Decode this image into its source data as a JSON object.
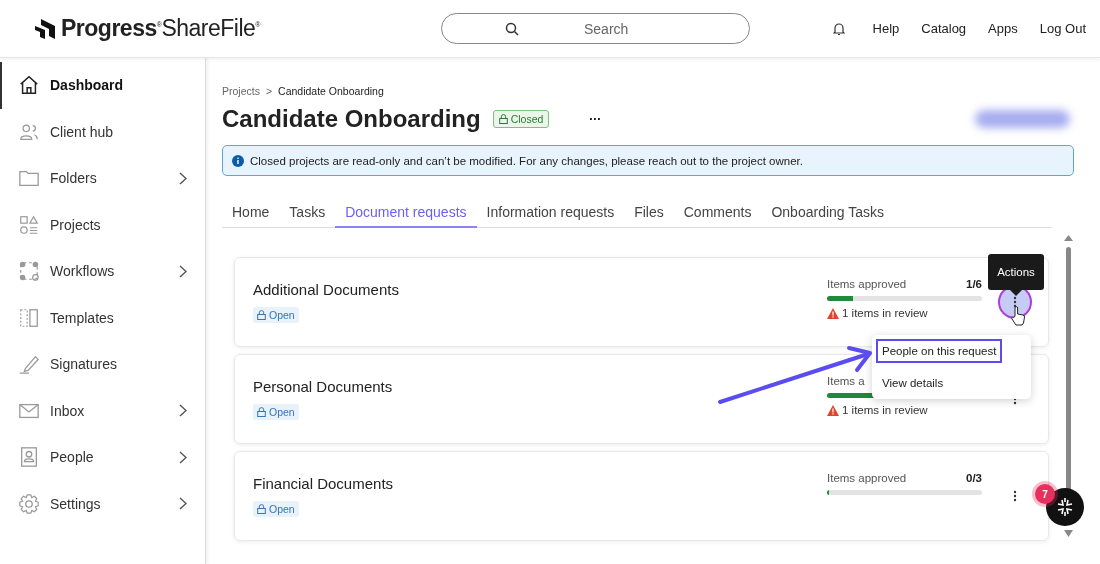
{
  "header": {
    "logo": "**Progress**$^{®}$ShareFile$^{®}$",
    "search": {
      "placeholder": "Search"
    },
    "links": [
      "Help",
      "Catalog",
      "Apps",
      "Log Out"
    ]
  },
  "sidebar": {
    "items": [
      {
        "label": "Dashboard",
        "kind": "home",
        "selected": true,
        "expandable": false
      },
      {
        "label": "Client hub",
        "kind": "users",
        "selected": false,
        "expandable": false
      },
      {
        "label": "Folders",
        "kind": "folder",
        "selected": false,
        "expandable": true
      },
      {
        "label": "Projects",
        "kind": "shapes",
        "selected": false,
        "expandable": false
      },
      {
        "label": "Workflows",
        "kind": "flow",
        "selected": false,
        "expandable": true
      },
      {
        "label": "Templates",
        "kind": "template",
        "selected": false,
        "expandable": false
      },
      {
        "label": "Signatures",
        "kind": "pen",
        "selected": false,
        "expandable": false
      },
      {
        "label": "Inbox",
        "kind": "mail",
        "selected": false,
        "expandable": true
      },
      {
        "label": "People",
        "kind": "person",
        "selected": false,
        "expandable": true
      },
      {
        "label": "Settings",
        "kind": "gear",
        "selected": false,
        "expandable": true
      }
    ]
  },
  "breadcrumb": [
    "Projects",
    ">",
    "Candidate Onboarding"
  ],
  "title": "Candidate Onboarding",
  "status": "Closed",
  "more": "···",
  "banner": "Closed projects are read-only and can’t be modified. For any changes, please reach out to the project owner.",
  "tabs": [
    {
      "label": "Home",
      "selected": false
    },
    {
      "label": "Tasks",
      "selected": false
    },
    {
      "label": "Document requests",
      "selected": true
    },
    {
      "label": "Information requests",
      "selected": false
    },
    {
      "label": "Files",
      "selected": false
    },
    {
      "label": "Comments",
      "selected": false
    },
    {
      "label": "Onboarding Tasks",
      "selected": false
    }
  ],
  "requests": [
    {
      "title": "Additional Documents",
      "status": "Open",
      "label": "Items approved",
      "count": "1/6",
      "level": 0.17,
      "review": "1 items in review",
      "active": true
    },
    {
      "title": "Personal Documents",
      "status": "Open",
      "label": "Items a",
      "level": 0.33,
      "review": "1 items in review",
      "active": false
    },
    {
      "title": "Financial Documents",
      "status": "Open",
      "label": "Items approved",
      "count": "0/3",
      "level": 0.01,
      "active": false
    }
  ],
  "tooltip": "Actions",
  "menu": [
    {
      "label": "People on this request",
      "selected": true
    },
    {
      "label": "View details",
      "selected": false
    }
  ],
  "chat_badge": "7"
}
